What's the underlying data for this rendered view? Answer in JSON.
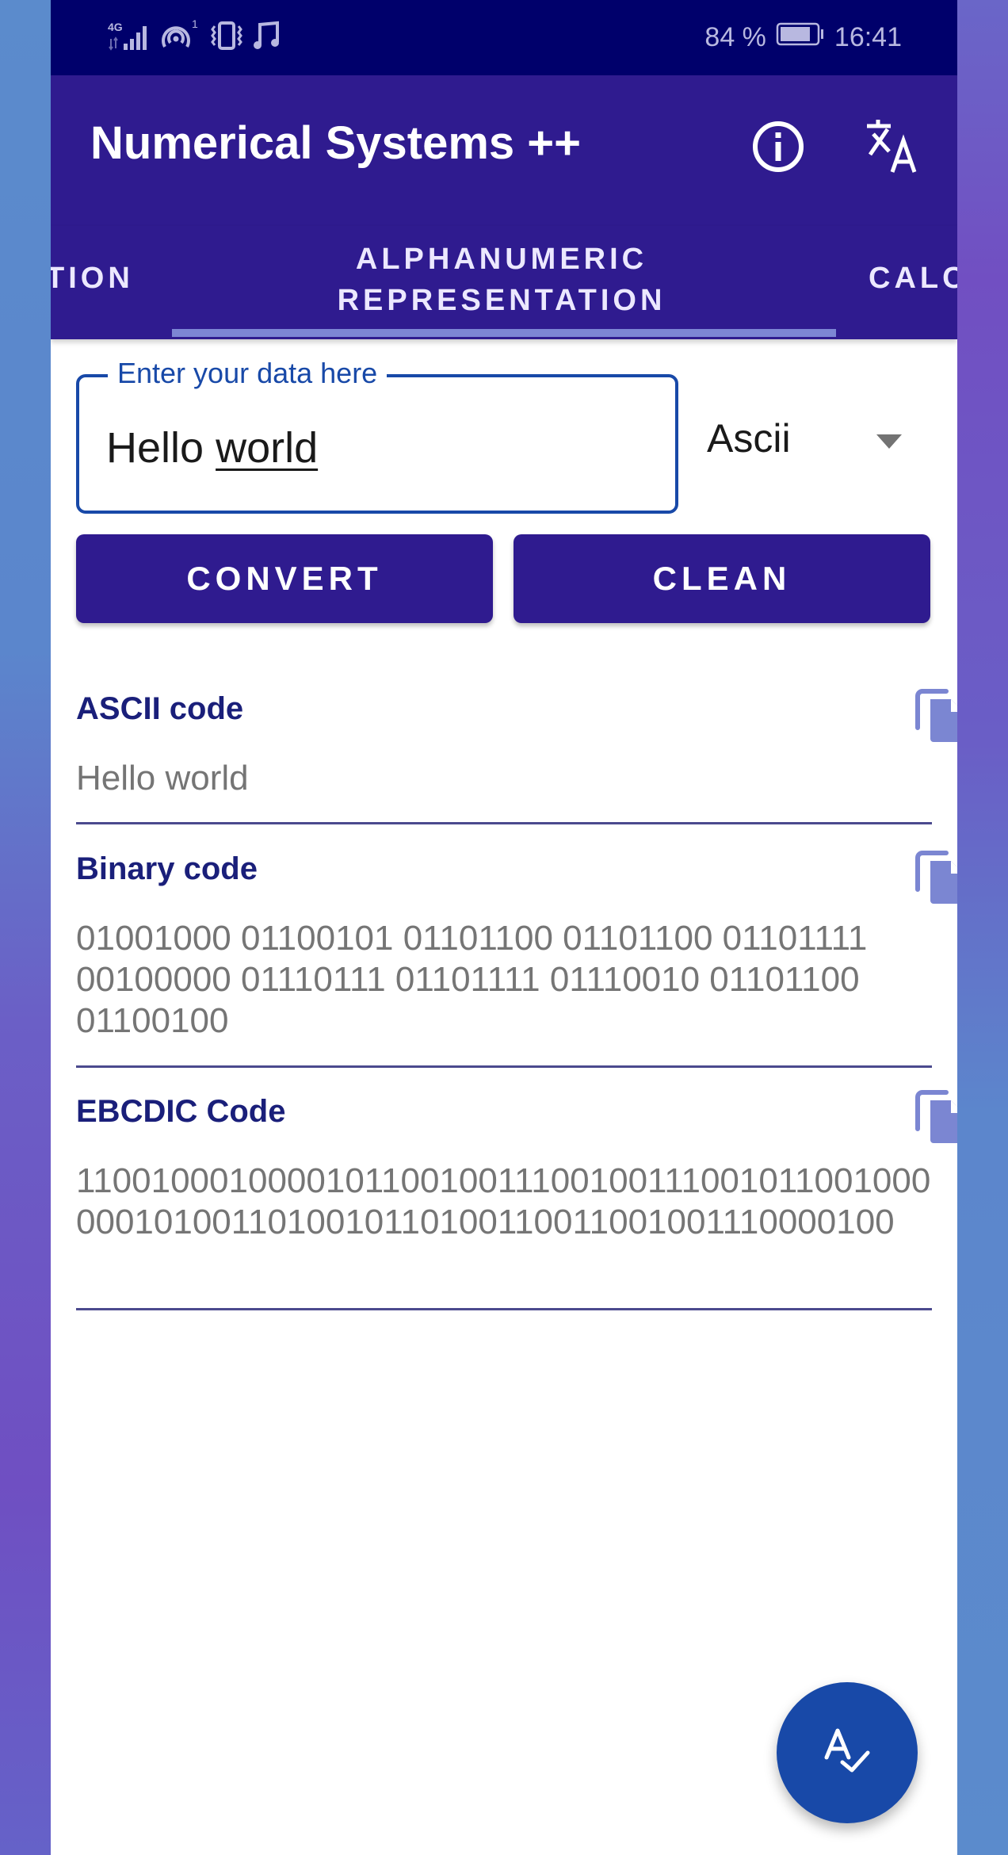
{
  "status_bar": {
    "network_type": "4G",
    "hotspot_count": "1",
    "battery_percent": "84 %",
    "battery_level": 0.84,
    "time": "16:41",
    "icons": [
      "signal-icon",
      "hotspot-icon",
      "vibrate-icon",
      "music-note-icon",
      "battery-icon"
    ]
  },
  "app_bar": {
    "title": "Numerical Systems ++",
    "actions": [
      "info-icon",
      "translate-icon"
    ]
  },
  "tabs": [
    {
      "label": "TION",
      "active": false
    },
    {
      "label": "ALPHANUMERIC REPRESENTATION",
      "line1": "ALPHANUMERIC",
      "line2": "REPRESENTATION",
      "active": true
    },
    {
      "label": "CALC",
      "active": false
    }
  ],
  "input": {
    "label": "Enter your data here",
    "value_word1": "Hello",
    "value_word2": "world",
    "value": "Hello world"
  },
  "encoding_select": {
    "selected": "Ascii"
  },
  "buttons": {
    "convert": "CONVERT",
    "clean": "CLEAN"
  },
  "results": [
    {
      "title": "ASCII code",
      "value": "Hello world"
    },
    {
      "title": "Binary code",
      "value": "01001000 01100101 01101100 01101100 01101111 00100000 01110111 01101111 01110010 01101100 01100100"
    },
    {
      "title": "EBCDIC Code",
      "value": "1100100010000101100100111001001110010110010000001010011010010110100110011001001110000100"
    }
  ],
  "fab": {
    "icon": "spellcheck-icon"
  },
  "colors": {
    "status_bar": "#00006b",
    "primary": "#2f1b8f",
    "accent": "#1849a8",
    "tab_indicator": "#7d86d4",
    "section_title": "#1a1f7a",
    "copy_icon": "#7b86d2",
    "value_text": "#757575"
  }
}
